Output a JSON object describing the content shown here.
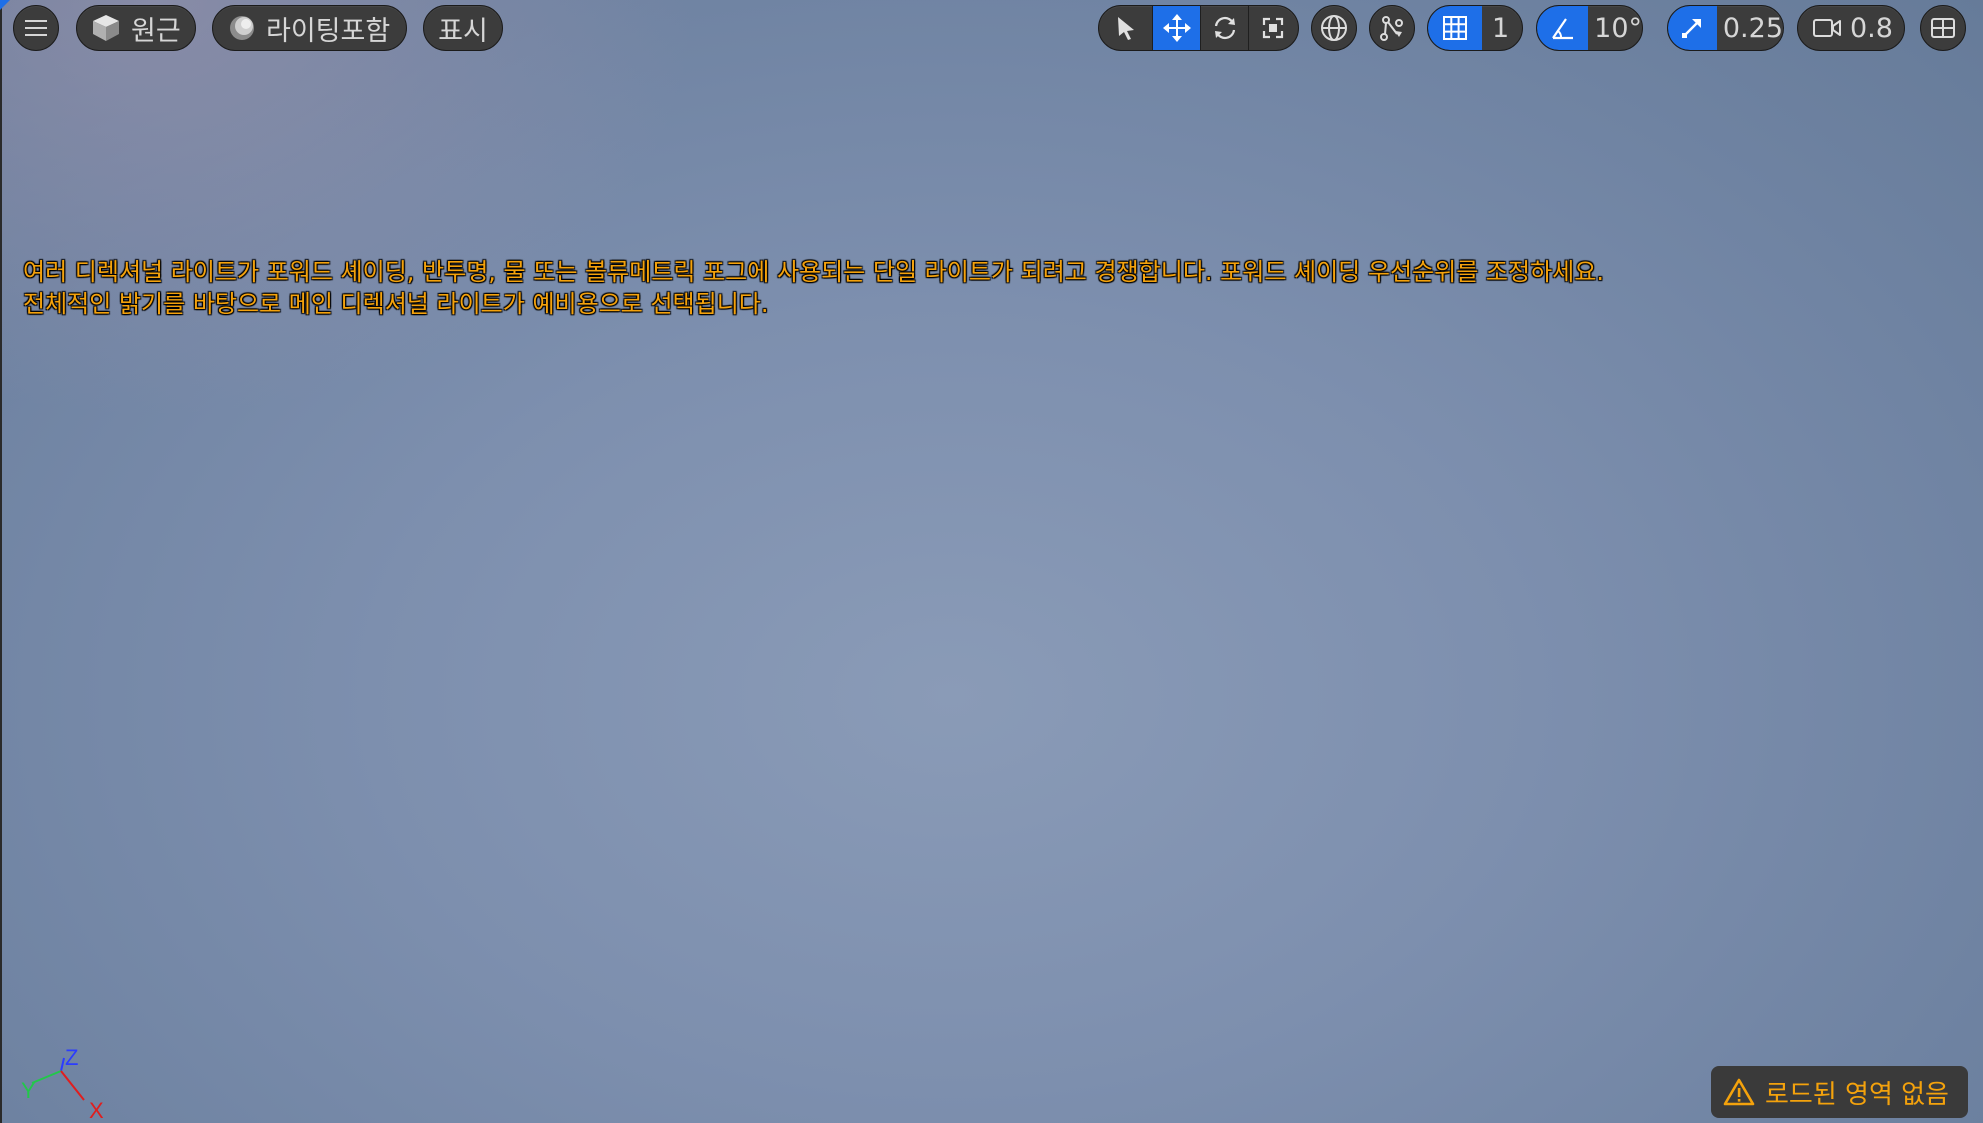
{
  "toolbar": {
    "view_mode_label": "원근",
    "lighting_mode_label": "라이팅포함",
    "show_label": "표시",
    "grid_snap_value": "1",
    "rotation_snap_value": "10°",
    "scale_snap_value": "0.25",
    "camera_speed_value": "0.8",
    "active_transform_tool": "translate",
    "accent_color": "#1e6fe8"
  },
  "viewport": {
    "warning_line_1": "여러 디렉셔널 라이트가 포워드 셰이딩, 반투명, 물 또는 볼류메트릭 포그에 사용되는 단일 라이트가 되려고 경쟁합니다. 포워드 셰이딩 우선순위를 조정하세요.",
    "warning_line_2": "전체적인 밝기를 바탕으로 메인 디렉셔널 라이트가 예비용으로 선택됩니다.",
    "warning_color": "#f4a20c",
    "axis_labels": {
      "z": "Z",
      "y": "Y",
      "x": "X"
    },
    "region_status": "로드된 영역 없음"
  }
}
